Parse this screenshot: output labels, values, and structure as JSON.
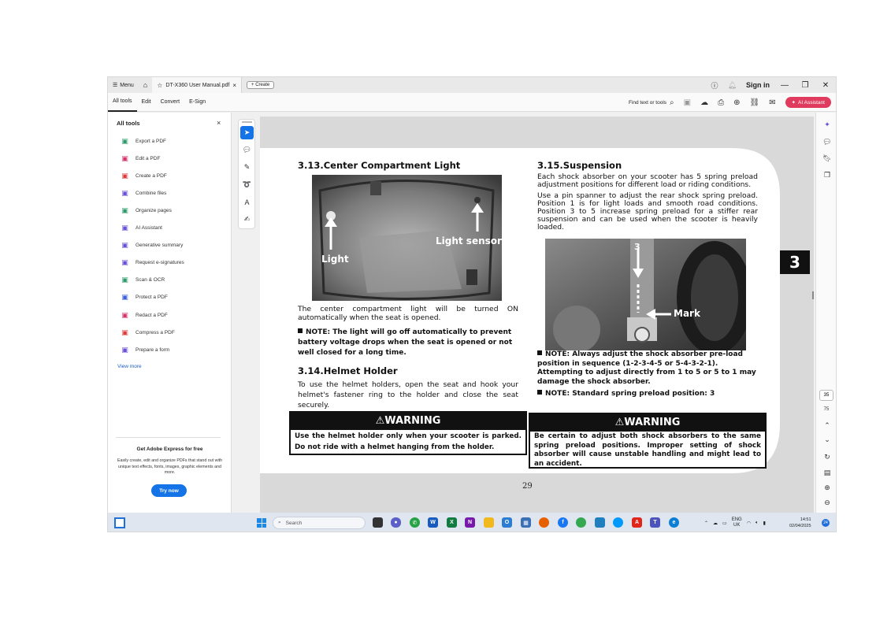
{
  "titlebar": {
    "menu_label": "Menu",
    "tab_title": "DT-X360 User Manual.pdf",
    "create_label": "Create",
    "sign_in": "Sign in"
  },
  "menubar": {
    "tabs": [
      "All tools",
      "Edit",
      "Convert",
      "E-Sign"
    ],
    "find_label": "Find text or tools",
    "ai_assistant": "AI Assistant"
  },
  "left_panel": {
    "title": "All tools",
    "tools": [
      {
        "label": "Export a PDF",
        "icon": "export-pdf-icon",
        "color": "#2e9b6a"
      },
      {
        "label": "Edit a PDF",
        "icon": "edit-pdf-icon",
        "color": "#d6336c"
      },
      {
        "label": "Create a PDF",
        "icon": "create-pdf-icon",
        "color": "#e03b3b"
      },
      {
        "label": "Combine files",
        "icon": "combine-files-icon",
        "color": "#6a4fd8"
      },
      {
        "label": "Organize pages",
        "icon": "organize-pages-icon",
        "color": "#2e9b6a"
      },
      {
        "label": "AI Assistant",
        "icon": "ai-assistant-icon",
        "color": "#6a4fd8"
      },
      {
        "label": "Generative summary",
        "icon": "generative-summary-icon",
        "color": "#6a4fd8"
      },
      {
        "label": "Request e-signatures",
        "icon": "request-esignatures-icon",
        "color": "#6a4fd8"
      },
      {
        "label": "Scan & OCR",
        "icon": "scan-ocr-icon",
        "color": "#2e9b6a"
      },
      {
        "label": "Protect a PDF",
        "icon": "protect-pdf-icon",
        "color": "#3a5fd9"
      },
      {
        "label": "Redact a PDF",
        "icon": "redact-pdf-icon",
        "color": "#d6336c"
      },
      {
        "label": "Compress a PDF",
        "icon": "compress-pdf-icon",
        "color": "#e03b3b"
      },
      {
        "label": "Prepare a form",
        "icon": "prepare-form-icon",
        "color": "#6a4fd8"
      }
    ],
    "view_more": "View more",
    "promo_title": "Get Adobe Express for free",
    "promo_text": "Easily create, edit and organize PDFs that stand out with unique text effects, fonts, images, graphic elements and more.",
    "try_now": "Try now"
  },
  "document": {
    "chapter_tab": "3",
    "left": {
      "heading1": "3.13.Center Compartment Light",
      "photo_label_light": "Light",
      "photo_label_sensor": "Light sensor",
      "para1": "The center compartment light will be turned ON automatically when the seat is opened.",
      "note1": "NOTE: The light will go off automatically to prevent battery voltage drops when the seat is opened or not well closed for a long time.",
      "heading2": "3.14.Helmet Holder",
      "para2": "To use the helmet holders, open the seat and hook your helmet's fastener ring to the holder and close the seat securely.",
      "warning_title": "WARNING",
      "warning_text": "Use the helmet holder only when your scooter is parked. Do not ride with a helmet hanging from the holder."
    },
    "right": {
      "heading": "3.15.Suspension",
      "para1": "Each shock absorber on your scooter has 5 spring preload adjustment positions for different load or riding conditions.",
      "para2": "Use a pin spanner to adjust the rear shock spring preload. Position 1 is for light loads and smooth road conditions. Position 3 to 5 increase spring preload for a stiffer rear suspension and can be used when the scooter is heavily loaded.",
      "photo_label_number": "3",
      "photo_label_mark": "Mark",
      "note1": "NOTE: Always adjust the shock absorber pre-load position in sequence (1-2-3-4-5 or 5-4-3-2-1). Attempting to adjust directly from 1 to 5 or 5 to 1 may damage the shock absorber.",
      "note2": "NOTE: Standard spring preload position: 3",
      "warning_title": "WARNING",
      "warning_text": "Be certain to adjust both shock absorbers to the same spring preload positions. Improper setting of shock absorber will cause unstable handling and might lead to an accident."
    },
    "page_number": "29"
  },
  "right_rail": {
    "current_page": "35",
    "total_pages": "75"
  },
  "taskbar": {
    "search_placeholder": "Search",
    "lang": "ENG",
    "region": "UK",
    "time": "14:51",
    "date": "02/04/2025",
    "notification_count": "24"
  }
}
